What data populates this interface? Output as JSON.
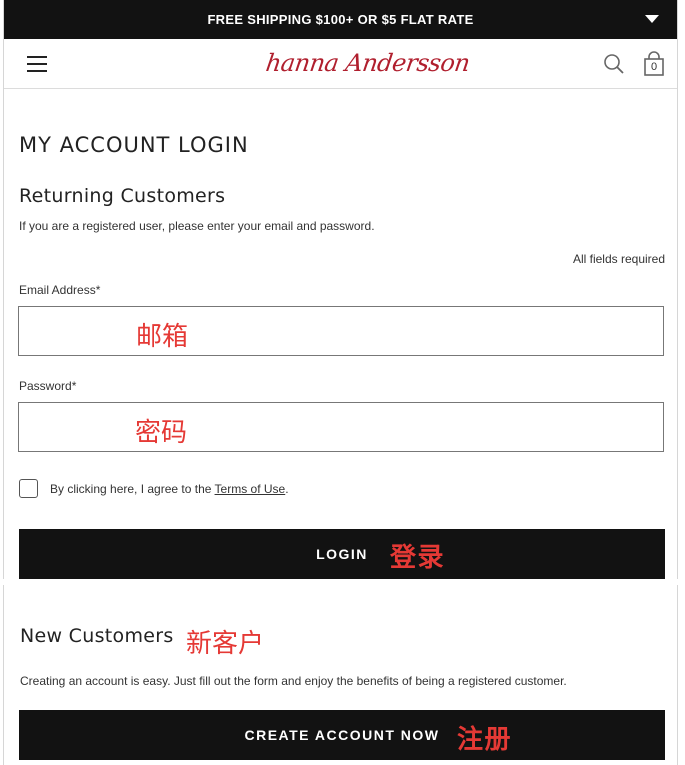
{
  "promo": {
    "text": "FREE SHIPPING $100+ OR $5 FLAT RATE"
  },
  "header": {
    "logo_text": "hanna Andersson",
    "bag_count": "0"
  },
  "page": {
    "title": "MY ACCOUNT LOGIN",
    "returning": {
      "heading": "Returning Customers",
      "intro": "If you are a registered user, please enter your email and password.",
      "required_note": "All fields required",
      "email_label": "Email Address*",
      "email_annotation": "邮箱",
      "password_label": "Password*",
      "password_annotation": "密码",
      "terms_prefix": "By clicking here, I agree to the ",
      "terms_link": "Terms of Use",
      "terms_suffix": ".",
      "login_label": "LOGIN",
      "login_annotation": "登录"
    },
    "new_customers": {
      "heading": "New Customers",
      "heading_annotation": "新客户",
      "text": "Creating an account is easy. Just fill out the form and enjoy the benefits of being a registered customer.",
      "create_label": "CREATE ACCOUNT NOW",
      "create_annotation": "注册"
    }
  },
  "colors": {
    "promo_bg": "#121212",
    "brand_red": "#b01f2e",
    "annotation_red": "#e53935",
    "button_bg": "#121212"
  },
  "icons": [
    "caret-down-icon",
    "hamburger-menu-icon",
    "search-icon",
    "shopping-bag-icon",
    "checkbox-icon"
  ]
}
